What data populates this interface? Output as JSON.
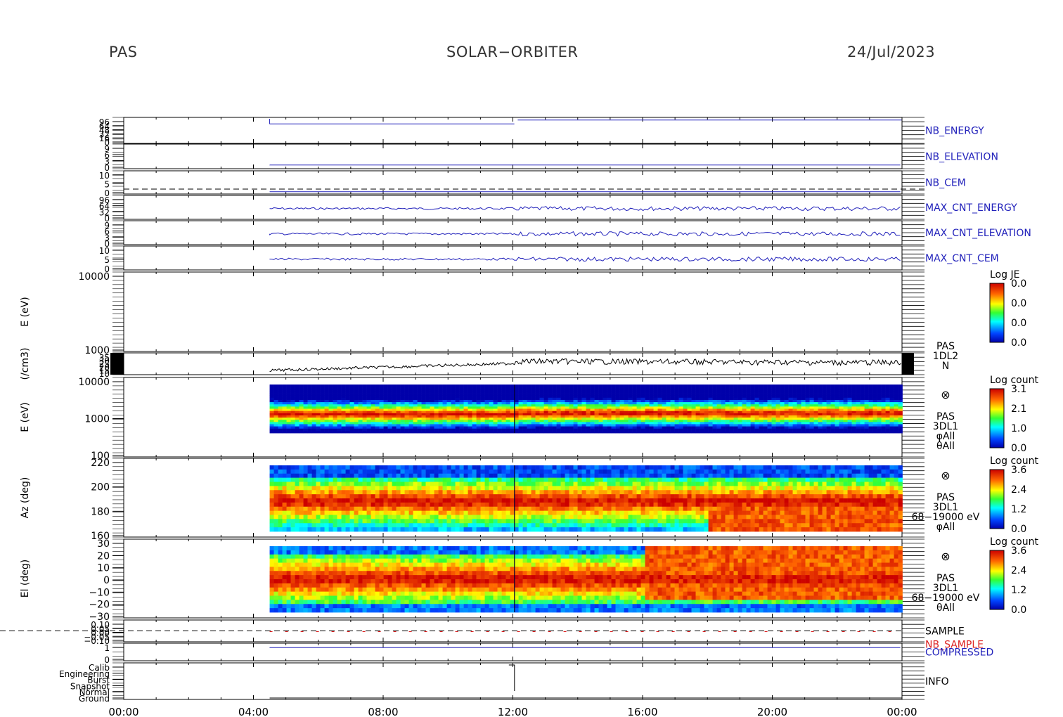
{
  "header": {
    "left": "PAS",
    "center": "SOLAR−ORBITER",
    "right": "24/Jul/2023"
  },
  "colors": {
    "blue": "#2222bb",
    "red": "#dd2222",
    "axis": "#000000"
  },
  "chart_data": {
    "type": "heatmap",
    "x_axis": {
      "range_hours": [
        0,
        24
      ],
      "ticks": [
        "00:00",
        "04:00",
        "08:00",
        "12:00",
        "16:00",
        "20:00",
        "00:00"
      ]
    },
    "data_start_hours": 4.5,
    "shock_time_hours": 12.05,
    "panels": [
      {
        "id": "nb_energy",
        "type": "line",
        "label": "NB_ENERGY",
        "label_color": "blue",
        "tick_labels": [
          "96",
          "64",
          "48",
          "32",
          "16",
          "0"
        ],
        "segments": [
          [
            4.5,
            12.1,
            0.25
          ],
          [
            12.15,
            24,
            0.1
          ]
        ]
      },
      {
        "id": "nb_elevation",
        "type": "line",
        "label": "NB_ELEVATION",
        "label_color": "blue",
        "tick_labels": [
          "9",
          "6",
          "3",
          "0"
        ],
        "segments": [
          [
            4.5,
            24,
            0.85
          ]
        ]
      },
      {
        "id": "nb_cem",
        "type": "line",
        "label": "NB_CEM",
        "label_color": "blue",
        "tick_labels": [
          "10",
          "5",
          "0"
        ],
        "segments": [
          [
            4.5,
            24,
            0.9
          ]
        ]
      },
      {
        "id": "max_cnt_energy",
        "type": "line",
        "label": "MAX_CNT_ENERGY",
        "label_color": "blue",
        "tick_labels": [
          "96",
          "64",
          "32",
          "0"
        ],
        "segments": [
          [
            4.5,
            24,
            0.55
          ]
        ]
      },
      {
        "id": "max_cnt_elevation",
        "type": "line",
        "label": "MAX_CNT_ELEVATION",
        "label_color": "blue",
        "tick_labels": [
          "9",
          "6",
          "3",
          "0"
        ],
        "segments": [
          [
            4.5,
            24,
            0.55
          ]
        ]
      },
      {
        "id": "max_cnt_cem",
        "type": "line",
        "label": "MAX_CNT_CEM",
        "label_color": "blue",
        "tick_labels": [
          "10",
          "5",
          "0"
        ],
        "segments": [
          [
            4.5,
            24,
            0.55
          ]
        ]
      },
      {
        "id": "spectrogram_je",
        "type": "empty",
        "ylabel": "E (eV)",
        "tick_labels": [
          "10000",
          "1000"
        ],
        "colorbar": {
          "title": "Log JE",
          "labels": [
            "0.0",
            "0.0",
            "0.0",
            "0.0"
          ]
        }
      },
      {
        "id": "density",
        "type": "line",
        "ylabel": "(/cm3)",
        "tick_labels": [
          "35",
          "30",
          "25",
          "20",
          "15",
          "10"
        ],
        "side_labels": [
          "PAS",
          "1DL2",
          "N"
        ],
        "density_before_shock": [
          12,
          19
        ],
        "density_after_shock": [
          27,
          22
        ]
      },
      {
        "id": "energy_spectrogram",
        "type": "heatmap",
        "ylabel": "E (eV)",
        "tick_labels": [
          "10000",
          "1000",
          "100"
        ],
        "side_labels": [
          "PAS",
          "3DL1",
          "φAll",
          "θAll"
        ],
        "colorbar": {
          "title": "Log count",
          "labels": [
            "3.1",
            "2.1",
            "1.0",
            "0.0"
          ]
        }
      },
      {
        "id": "azimuth_spectrogram",
        "type": "heatmap",
        "ylabel": "Az (deg)",
        "tick_labels": [
          "220",
          "200",
          "180",
          "160"
        ],
        "side_labels": [
          "PAS",
          "3DL1",
          "68−19000 eV",
          "φAll"
        ],
        "colorbar": {
          "title": "Log count",
          "labels": [
            "3.6",
            "2.4",
            "1.2",
            "0.0"
          ]
        }
      },
      {
        "id": "elevation_spectrogram",
        "type": "heatmap",
        "ylabel": "El (deg)",
        "tick_labels": [
          "30",
          "20",
          "10",
          "0",
          "−10",
          "−20",
          "−30"
        ],
        "side_labels": [
          "PAS",
          "3DL1",
          "68−19000 eV",
          "θAll"
        ],
        "colorbar": {
          "title": "Log count",
          "labels": [
            "3.6",
            "2.4",
            "1.2",
            "0.0"
          ]
        }
      },
      {
        "id": "sample",
        "type": "dashed",
        "label": "SAMPLE",
        "label2": "NB_SAMPLE",
        "tick_labels": [
          "0.10",
          "0.05",
          "0.00",
          "−0.05",
          "−0.10"
        ]
      },
      {
        "id": "compressed",
        "type": "line",
        "label": "COMPRESSED",
        "label_color": "blue",
        "tick_labels": [
          "1",
          "0"
        ],
        "segments": [
          [
            4.5,
            24,
            0.25
          ]
        ]
      },
      {
        "id": "info",
        "type": "line",
        "label": "INFO",
        "tick_labels": [
          "Calib",
          "Engineering",
          "Burst",
          "Snapshot",
          "Normal",
          "Ground"
        ]
      }
    ]
  }
}
